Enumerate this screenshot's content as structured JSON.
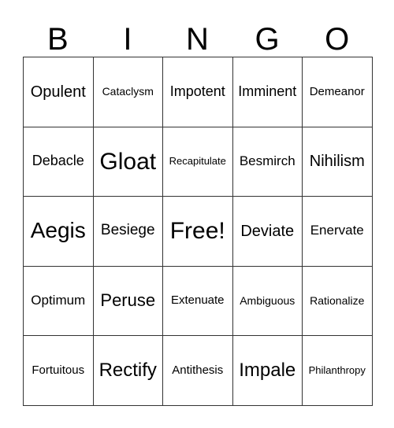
{
  "header": [
    "B",
    "I",
    "N",
    "G",
    "O"
  ],
  "rows": [
    [
      "Opulent",
      "Cataclysm",
      "Impotent",
      "Imminent",
      "Demeanor"
    ],
    [
      "Debacle",
      "Gloat",
      "Recapitulate",
      "Besmirch",
      "Nihilism"
    ],
    [
      "Aegis",
      "Besiege",
      "Free!",
      "Deviate",
      "Enervate"
    ],
    [
      "Optimum",
      "Peruse",
      "Extenuate",
      "Ambiguous",
      "Rationalize"
    ],
    [
      "Fortuitous",
      "Rectify",
      "Antithesis",
      "Impale",
      "Philanthropy"
    ]
  ]
}
